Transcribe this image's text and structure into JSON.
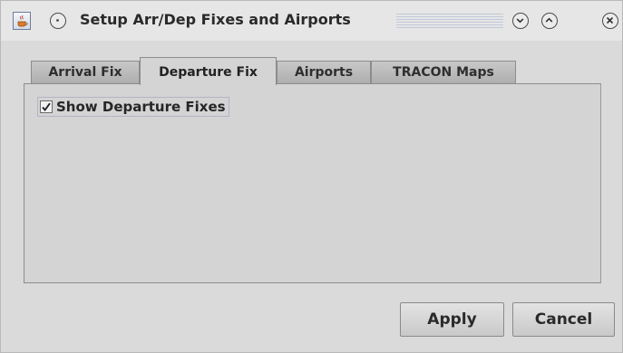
{
  "window": {
    "title": "Setup Arr/Dep Fixes and Airports",
    "icons": {
      "app": "java-cup-icon",
      "menu": "window-menu-icon",
      "minimize": "minimize-chevron-down-icon",
      "maximize": "maximize-chevron-up-icon",
      "close": "close-x-icon"
    }
  },
  "tabs": [
    {
      "label": "Arrival Fix",
      "selected": false
    },
    {
      "label": "Departure Fix",
      "selected": true
    },
    {
      "label": "Airports",
      "selected": false
    },
    {
      "label": "TRACON Maps",
      "selected": false
    }
  ],
  "departure_panel": {
    "show_fixes_label": "Show Departure Fixes",
    "show_fixes_checked": true
  },
  "buttons": {
    "apply": "Apply",
    "cancel": "Cancel"
  }
}
